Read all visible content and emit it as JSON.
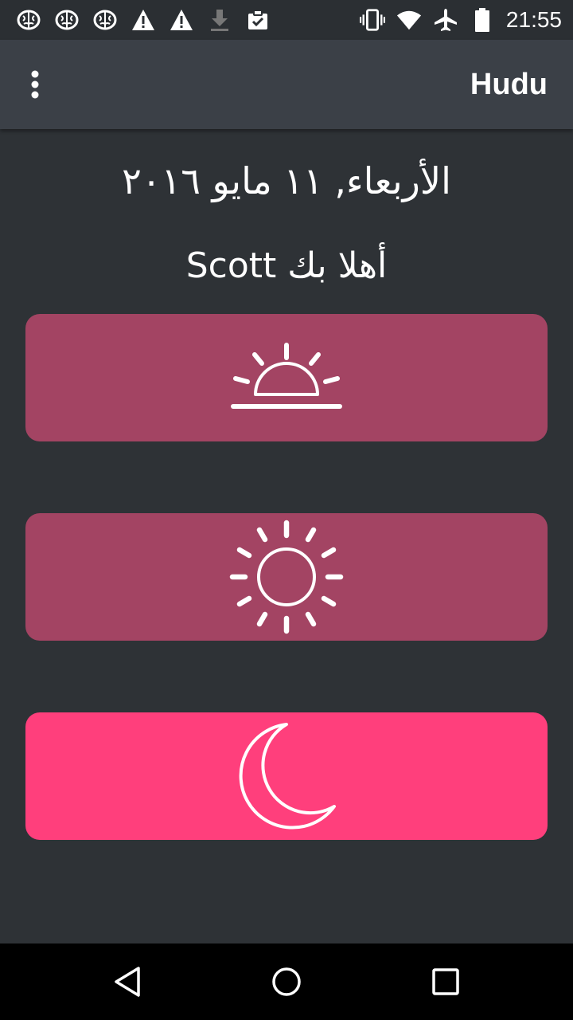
{
  "status_bar": {
    "time": "21:55",
    "left_icons": [
      "brain-icon",
      "brain-icon",
      "brain-icon",
      "warning-icon",
      "warning-icon",
      "download-icon",
      "clipboard-check-icon"
    ],
    "right_icons": [
      "vibrate-icon",
      "wifi-icon",
      "airplane-icon",
      "battery-icon"
    ]
  },
  "app_bar": {
    "title": "Hudu",
    "menu_icon": "overflow-menu-icon"
  },
  "main": {
    "date": "الأربعاء, ١١ مايو ٢٠١٦",
    "greeting": "أهلا بك Scott",
    "buttons": [
      {
        "icon": "sunrise-icon",
        "color": "#a34463"
      },
      {
        "icon": "sun-icon",
        "color": "#a34463"
      },
      {
        "icon": "moon-icon",
        "color": "#ff3f7c"
      }
    ]
  },
  "nav_bar": {
    "icons": [
      "back-icon",
      "home-icon",
      "recents-icon"
    ]
  }
}
